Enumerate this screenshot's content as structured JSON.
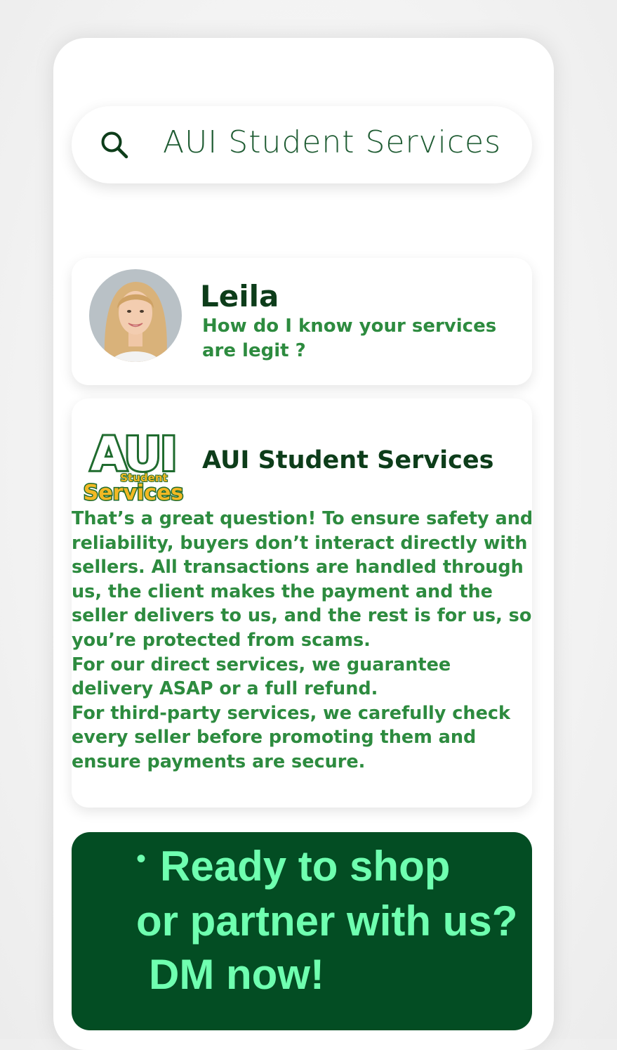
{
  "search": {
    "icon": "search-icon",
    "value": "AUI Student Services"
  },
  "message": {
    "sender": "Leila",
    "text": "How do I know your services are legit ?"
  },
  "reply": {
    "sender": "AUI Student Services",
    "logo_text_main": "AUI",
    "logo_text_sub1": "Student",
    "logo_text_sub2": "Services",
    "paragraphs": [
      "That’s a great question! To ensure safety and reliability, buyers don’t interact directly with sellers. All transactions are handled through us, the client makes the payment and the seller delivers to us, and the rest is for us, so you’re protected from scams.",
      "For our direct services, we guarantee delivery ASAP or a full refund.",
      "For third-party services, we carefully check every seller before promoting them and ensure payments are secure."
    ]
  },
  "cta": {
    "bullet": "•",
    "line1": "Ready to shop",
    "line2": "or partner with us?",
    "line3": "DM now!"
  },
  "colors": {
    "dark_green": "#034d23",
    "text_green": "#2d8b3f",
    "cta_text": "#6fffb0",
    "logo_gold": "#f2b824"
  }
}
